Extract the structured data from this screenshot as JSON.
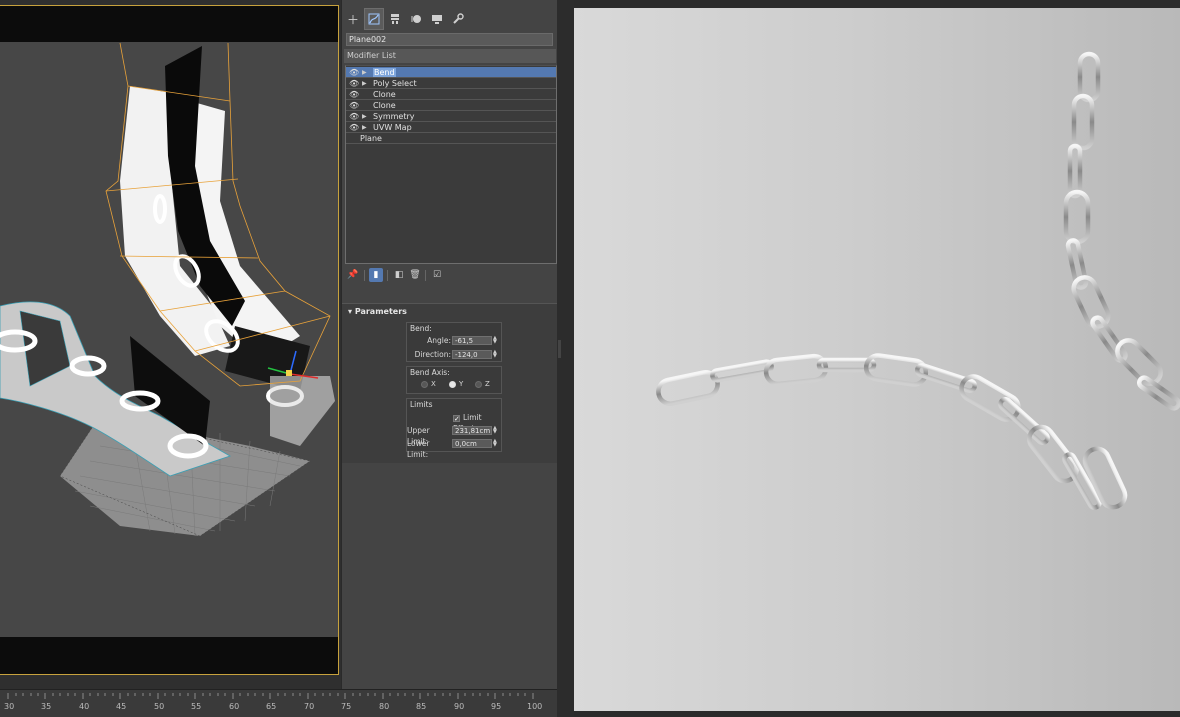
{
  "toolbar_icons": [
    "create-icon",
    "modify-icon",
    "hierarchy-icon",
    "motion-icon",
    "display-icon",
    "utilities-icon"
  ],
  "object_name": "Plane002",
  "modifier_list_label": "Modifier List",
  "modifier_stack": [
    {
      "label": "Bend",
      "selected": true,
      "has_toggle": true
    },
    {
      "label": "Poly Select",
      "selected": false,
      "has_toggle": true
    },
    {
      "label": "Clone",
      "selected": false,
      "has_toggle": false
    },
    {
      "label": "Clone",
      "selected": false,
      "has_toggle": false
    },
    {
      "label": "Symmetry",
      "selected": false,
      "has_toggle": true
    },
    {
      "label": "UVW Map",
      "selected": false,
      "has_toggle": true
    },
    {
      "label": "Plane",
      "selected": false,
      "has_toggle": false,
      "base": true
    }
  ],
  "parameters": {
    "title": "Parameters",
    "bend_group": "Bend:",
    "angle_label": "Angle:",
    "angle_value": "-61,5",
    "direction_label": "Direction:",
    "direction_value": "-124,0",
    "bend_axis_group": "Bend Axis:",
    "axis_x": "X",
    "axis_y": "Y",
    "axis_z": "Z",
    "selected_axis": "Y",
    "limits_group": "Limits",
    "limit_effect_label": "Limit Effect",
    "limit_effect_checked": true,
    "upper_limit_label": "Upper Limit:",
    "upper_limit_value": "231,81cm",
    "lower_limit_label": "Lower Limit:",
    "lower_limit_value": "0,0cm"
  },
  "timeline": {
    "labels": [
      "30",
      "35",
      "40",
      "45",
      "50",
      "55",
      "60",
      "65",
      "70",
      "75",
      "80",
      "85",
      "90",
      "95",
      "100"
    ]
  },
  "colors": {
    "selection_blue": "#5479b1",
    "viewport_border": "#c7a23d"
  }
}
